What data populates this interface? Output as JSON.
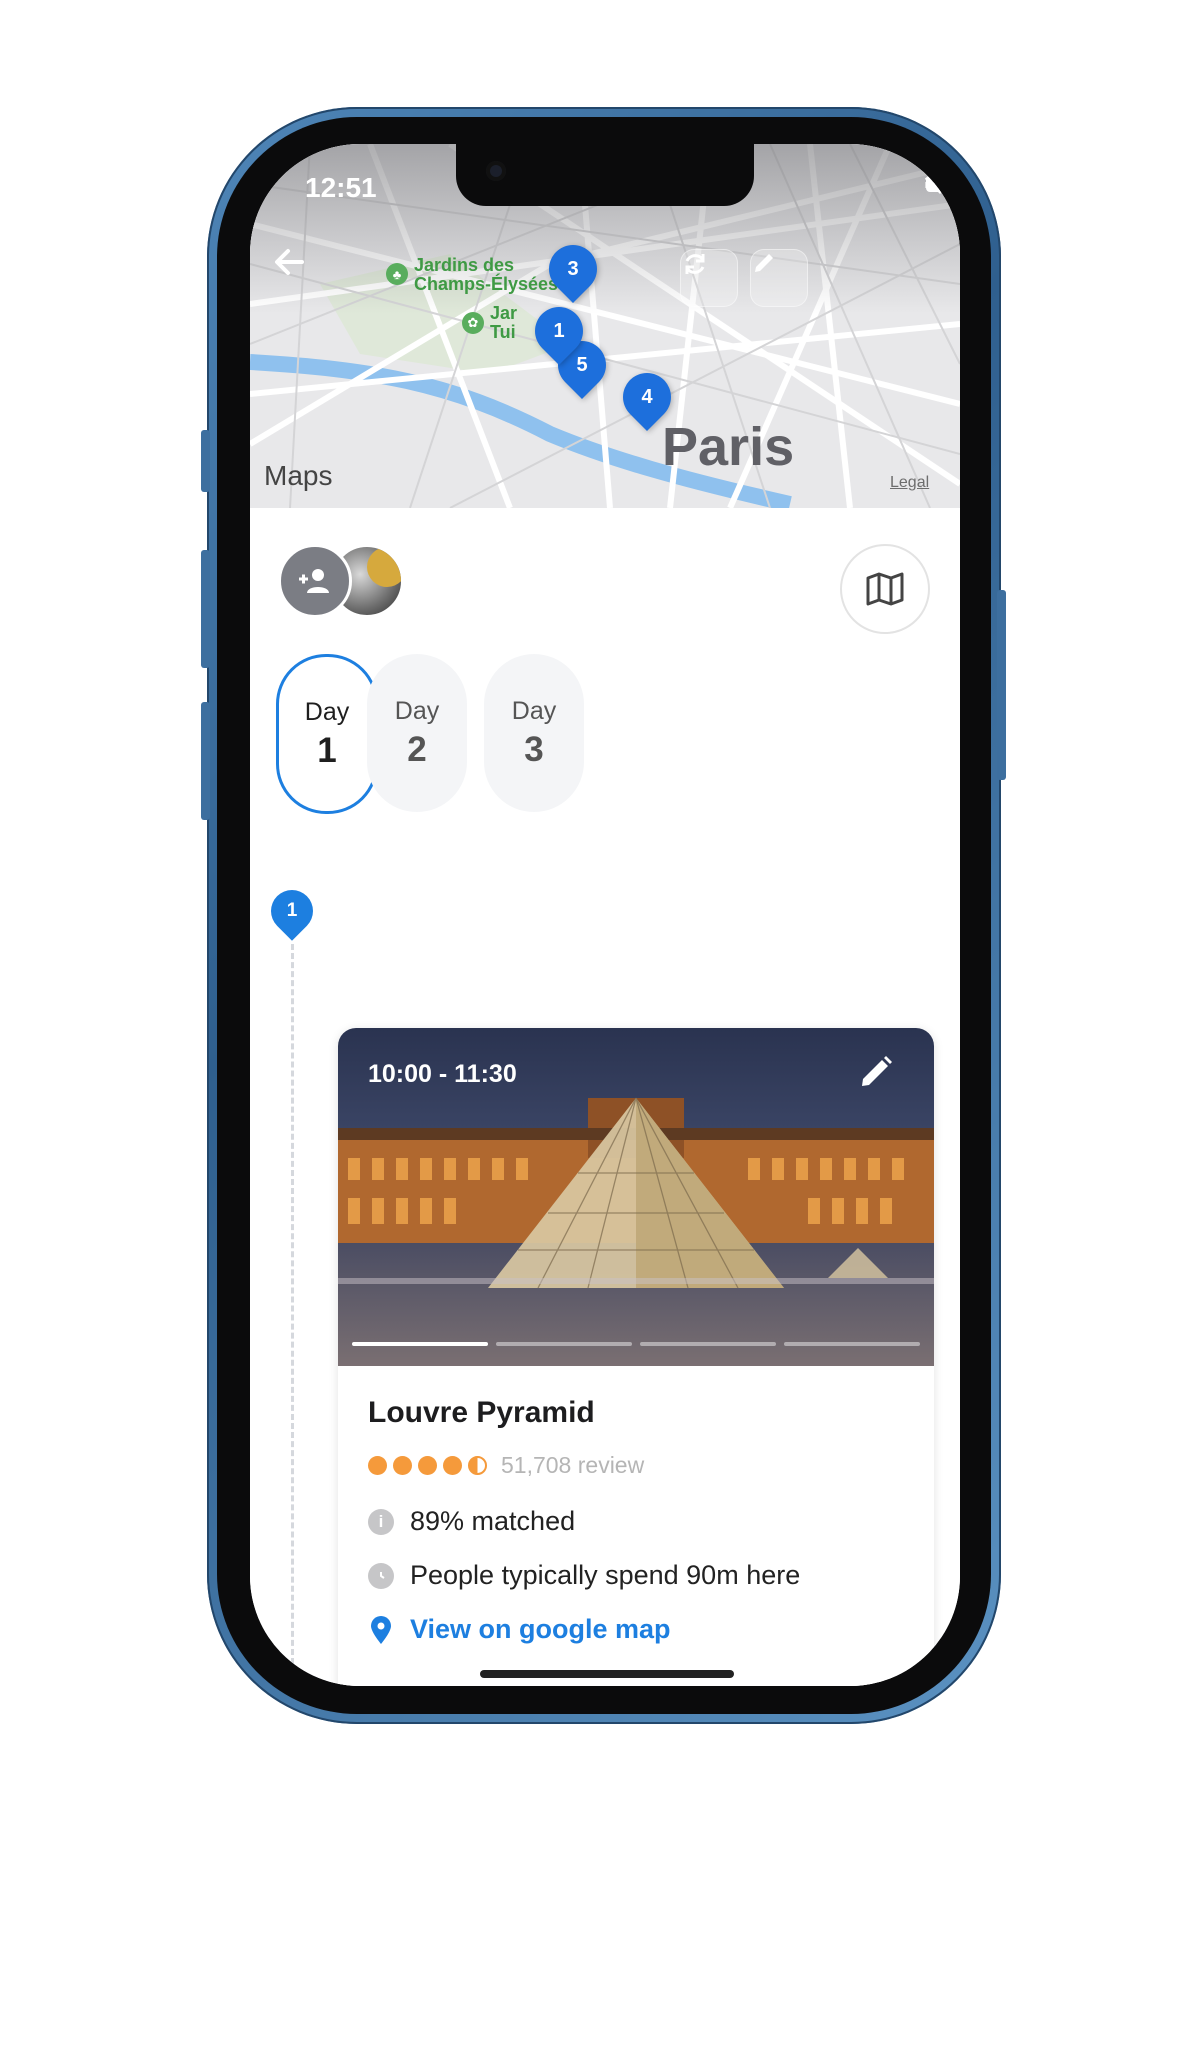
{
  "status_bar": {
    "time": "12:51"
  },
  "map": {
    "park_label_1": "Jardins des\nChamps-Élysées",
    "park_label_2": "Jar",
    "park_label_2b": "Tui",
    "city_label": "Paris",
    "maps_brand": "Maps",
    "legal": "Legal",
    "pins": [
      "3",
      "1",
      "5",
      "4"
    ]
  },
  "icons": {
    "back": "arrow-left-icon",
    "refresh": "refresh-icon",
    "edit": "pencil-icon",
    "add_person": "add-person-icon",
    "map": "map-icon"
  },
  "days": [
    {
      "word": "Day",
      "num": "1"
    },
    {
      "word": "Day",
      "num": "2"
    },
    {
      "word": "Day",
      "num": "3"
    }
  ],
  "timeline": {
    "pin_number": "1"
  },
  "card": {
    "time_range": "10:00 - 11:30",
    "title": "Louvre Pyramid",
    "rating": 4.5,
    "reviews": "51,708 review",
    "matched": "89% matched",
    "spend": "People typically spend 90m here",
    "map_link": "View on google map",
    "photo_index": 1,
    "photo_count": 4
  },
  "colors": {
    "accent": "#1d7fe0",
    "star": "#f59a3b",
    "pin": "#1d6fdc"
  }
}
